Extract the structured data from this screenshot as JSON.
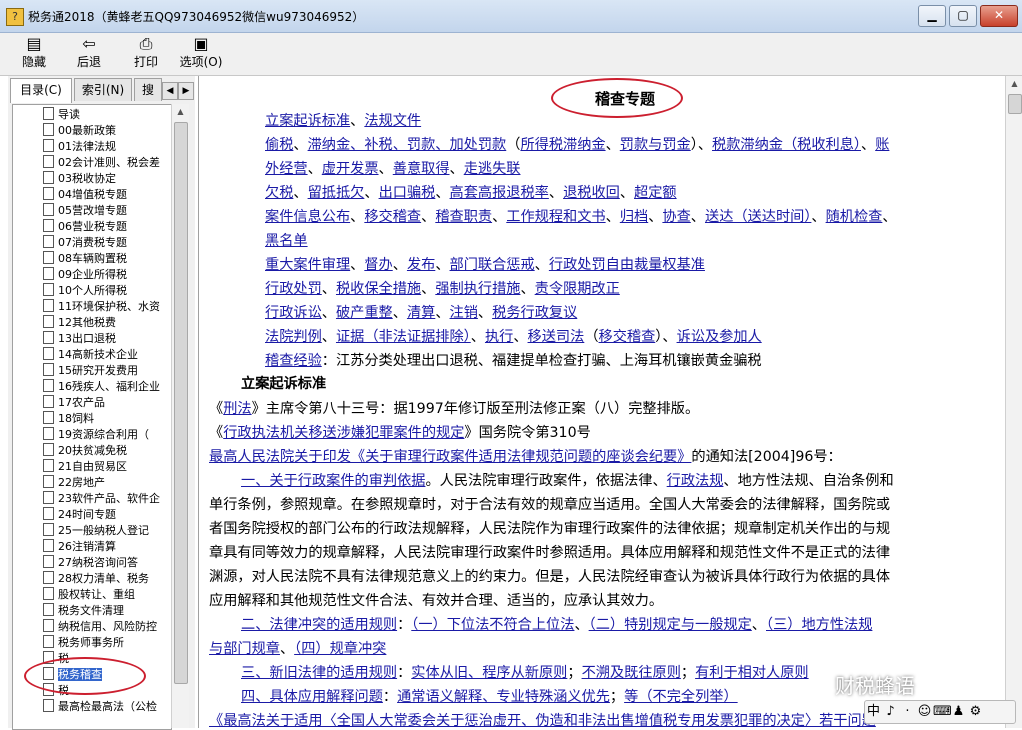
{
  "window": {
    "title": "税务通2018（黄蜂老五QQ973046952微信wu973046952）"
  },
  "toolbar": {
    "hide": "隐藏",
    "back": "后退",
    "print": "打印",
    "options": "选项(O)"
  },
  "tabs": {
    "contents": "目录(C)",
    "index": "索引(N)",
    "search": "搜"
  },
  "tree": [
    "导读",
    "00最新政策",
    "01法律法规",
    "02会计准则、税会差",
    "03税收协定",
    "04增值税专题",
    "05营改增专题",
    "06营业税专题",
    "07消费税专题",
    "08车辆购置税",
    "09企业所得税",
    "10个人所得税",
    "11环境保护税、水资",
    "12其他税费",
    "13出口退税",
    "14高新技术企业",
    "15研究开发费用",
    "16残疾人、福利企业",
    "17农产品",
    "18饲料",
    "19资源综合利用（",
    "20扶贫减免税",
    "21自由贸易区",
    "22房地产",
    "23软件产品、软件企",
    "24时间专题",
    "25一般纳税人登记",
    "26注销清算",
    "27纳税咨询问答",
    "28权力清单、税务",
    "股权转让、重组",
    "税务文件清理",
    "纳税信用、风险防控",
    "税务师事务所",
    "税",
    "税务稽查",
    "税",
    "最高检最高法（公检"
  ],
  "tree_selected_index": 35,
  "content": {
    "title": "稽查专题",
    "toc": [
      [
        [
          "立案起诉标准",
          "link"
        ],
        [
          "、",
          "text"
        ],
        [
          "法规文件",
          "link"
        ]
      ],
      [
        [
          "偷税",
          "link"
        ],
        [
          "、",
          "text"
        ],
        [
          "滞纳金、补税、罚款、加处罚款",
          "link"
        ],
        [
          "（",
          "text"
        ],
        [
          "所得税滞纳金",
          "link"
        ],
        [
          "、",
          "text"
        ],
        [
          "罚款与罚金",
          "link"
        ],
        [
          "）、",
          "text"
        ],
        [
          "税款滞纳金（税收利息）",
          "link"
        ],
        [
          "、",
          "text"
        ],
        [
          "账",
          "link"
        ]
      ],
      [
        [
          "外经营",
          "link"
        ],
        [
          "、",
          "text"
        ],
        [
          "虚开发票",
          "link"
        ],
        [
          "、",
          "text"
        ],
        [
          "善意取得",
          "link"
        ],
        [
          "、",
          "text"
        ],
        [
          "走逃失联",
          "link"
        ]
      ],
      [
        [
          "欠税",
          "link"
        ],
        [
          "、",
          "text"
        ],
        [
          "留抵抵欠",
          "link"
        ],
        [
          "、",
          "text"
        ],
        [
          "出口骗税",
          "link"
        ],
        [
          "、",
          "text"
        ],
        [
          "高套高报退税率",
          "link"
        ],
        [
          "、",
          "text"
        ],
        [
          "退税收回",
          "link"
        ],
        [
          "、",
          "text"
        ],
        [
          "超定额",
          "link"
        ]
      ],
      [
        [
          "案件信息公布",
          "link"
        ],
        [
          "、",
          "text"
        ],
        [
          "移交稽查",
          "link"
        ],
        [
          "、",
          "text"
        ],
        [
          "稽查职责",
          "link"
        ],
        [
          "、",
          "text"
        ],
        [
          "工作规程和文书",
          "link"
        ],
        [
          "、",
          "text"
        ],
        [
          "归档",
          "link"
        ],
        [
          "、",
          "text"
        ],
        [
          "协查",
          "link"
        ],
        [
          "、",
          "text"
        ],
        [
          "送达（送达时间）",
          "link"
        ],
        [
          "、",
          "text"
        ],
        [
          "随机检查",
          "link"
        ],
        [
          "、",
          "text"
        ]
      ],
      [
        [
          "黑名单",
          "link"
        ]
      ],
      [
        [
          "重大案件审理",
          "link"
        ],
        [
          "、",
          "text"
        ],
        [
          "督办",
          "link"
        ],
        [
          "、",
          "text"
        ],
        [
          "发布",
          "link"
        ],
        [
          "、",
          "text"
        ],
        [
          "部门联合惩戒",
          "link"
        ],
        [
          "、",
          "text"
        ],
        [
          "行政处罚自由裁量权基准",
          "link"
        ]
      ],
      [
        [
          "行政处罚",
          "link"
        ],
        [
          "、",
          "text"
        ],
        [
          "税收保全措施",
          "link"
        ],
        [
          "、",
          "text"
        ],
        [
          "强制执行措施",
          "link"
        ],
        [
          "、",
          "text"
        ],
        [
          "责令限期改正",
          "link"
        ]
      ],
      [
        [
          "行政诉讼",
          "link"
        ],
        [
          "、",
          "text"
        ],
        [
          "破产重整",
          "link"
        ],
        [
          "、",
          "text"
        ],
        [
          "清算",
          "link"
        ],
        [
          "、",
          "text"
        ],
        [
          "注销",
          "link"
        ],
        [
          "、",
          "text"
        ],
        [
          "税务行政复议",
          "link"
        ]
      ],
      [
        [
          "法院判例",
          "link"
        ],
        [
          "、",
          "text"
        ],
        [
          "证据（非法证据排除）",
          "link"
        ],
        [
          "、",
          "text"
        ],
        [
          "执行",
          "link"
        ],
        [
          "、",
          "text"
        ],
        [
          "移送司法",
          "link"
        ],
        [
          "（",
          "text"
        ],
        [
          "移交稽查",
          "link"
        ],
        [
          "）、",
          "text"
        ],
        [
          "诉讼及参加人",
          "link"
        ]
      ],
      [
        [
          "稽查经验",
          "link"
        ],
        [
          "：江苏分类处理出口退税、福建提单检查打骗、上海耳机镶嵌黄金骗税",
          "text"
        ]
      ]
    ],
    "section_heading": "立案起诉标准",
    "body": [
      [
        [
          "《",
          "text"
        ],
        [
          "刑法",
          "link"
        ],
        [
          "》主席令第八十三号：据1997年修订版至刑法修正案（八）完整排版。",
          "text"
        ]
      ],
      [
        [
          "《",
          "text"
        ],
        [
          "行政执法机关移送涉嫌犯罪案件的规定",
          "link"
        ],
        [
          "》国务院令第310号",
          "text"
        ]
      ],
      [
        [
          "最高人民法院关于印发《关于审理行政案件适用法律规范问题的座谈会纪要》",
          "link"
        ],
        [
          "的通知法[2004]96号：",
          "text"
        ]
      ],
      [
        [
          "一、关于行政案件的审判依据",
          "link"
        ],
        [
          "。人民法院审理行政案件，依据法律、",
          "text"
        ],
        [
          "行政法规",
          "link"
        ],
        [
          "、地方性法规、自治条例和",
          "text"
        ]
      ],
      [
        [
          "单行条例，参照规章。在参照规章时，对于合法有效的规章应当适用。全国人大常委会的法律解释，国务院或",
          "text"
        ]
      ],
      [
        [
          "者国务院授权的部门公布的行政法规解释，人民法院作为审理行政案件的法律依据；规章制定机关作出的与规",
          "text"
        ]
      ],
      [
        [
          "章具有同等效力的规章解释，人民法院审理行政案件时参照适用。具体应用解释和规范性文件不是正式的法律",
          "text"
        ]
      ],
      [
        [
          "渊源，对人民法院不具有法律规范意义上的约束力。但是，人民法院经审查认为被诉具体行政行为依据的具体",
          "text"
        ]
      ],
      [
        [
          "应用解释和其他规范性文件合法、有效并合理、适当的，应承认其效力。",
          "text"
        ]
      ],
      [
        [
          "二、法律冲突的适用规则",
          "link"
        ],
        [
          "：",
          "text"
        ],
        [
          "（一）下位法不符合上位法",
          "link"
        ],
        [
          "、",
          "text"
        ],
        [
          "（二）特别规定与一般规定",
          "link"
        ],
        [
          "、",
          "text"
        ],
        [
          "（三）地方性法规",
          "link"
        ]
      ],
      [
        [
          "与部门规章",
          "link"
        ],
        [
          "、",
          "text"
        ],
        [
          "（四）规章冲突",
          "link"
        ]
      ],
      [
        [
          "三、新旧法律的适用规则",
          "link"
        ],
        [
          "：",
          "text"
        ],
        [
          "实体从旧、程序从新原则",
          "link"
        ],
        [
          "；",
          "text"
        ],
        [
          "不溯及既往原则",
          "link"
        ],
        [
          "；",
          "text"
        ],
        [
          "有利于相对人原则",
          "link"
        ]
      ],
      [
        [
          "四、具体应用解释问题",
          "link"
        ],
        [
          "：",
          "text"
        ],
        [
          "通常语义解释、专业特殊涵义优先",
          "link"
        ],
        [
          "；",
          "text"
        ],
        [
          "等（不完全列举）",
          "link"
        ]
      ],
      [
        [
          "《最高法关于适用〈全国人大常委会关于惩治虚开、伪造和非法出售增值税专用发票犯罪的决定〉若干问题",
          "link"
        ]
      ]
    ]
  },
  "overlay": {
    "watermark": "财税蜂语",
    "ime": [
      "中",
      "♪",
      "·",
      "☺",
      "⌨",
      "♟",
      "⚙"
    ]
  },
  "colors": {
    "link": "#1a1aa6",
    "highlight_oval": "#cc1f2f",
    "selected": "#3366cc"
  }
}
